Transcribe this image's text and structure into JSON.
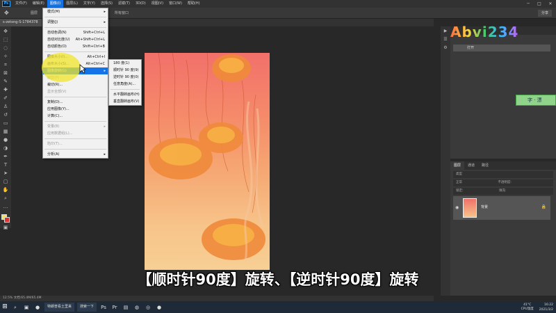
{
  "menubar": {
    "logo": "Ps",
    "items": [
      "文件(F)",
      "编辑(E)",
      "图像(I)",
      "图层(L)",
      "文字(Y)",
      "选择(S)",
      "滤镜(T)",
      "3D(D)",
      "视图(V)",
      "窗口(W)",
      "帮助(H)"
    ],
    "active_index": 2
  },
  "options": {
    "layer_select": "图层",
    "all_windows": "所有窗口",
    "share": "分享"
  },
  "document": {
    "tab_title": "s-zetong-S-1784378"
  },
  "status": {
    "zoom_info": "12.5%   文档:65.4M/65.4M"
  },
  "image_menu": {
    "items": [
      {
        "label": "模式(M)",
        "shortcut": "",
        "submenu": true,
        "disabled": false
      },
      {
        "sep": true
      },
      {
        "label": "调整(J)",
        "shortcut": "",
        "submenu": true,
        "disabled": false
      },
      {
        "sep": true
      },
      {
        "label": "自动色调(N)",
        "shortcut": "Shift+Ctrl+L",
        "submenu": false,
        "disabled": false
      },
      {
        "label": "自动对比度(U)",
        "shortcut": "Alt+Shift+Ctrl+L",
        "submenu": false,
        "disabled": false
      },
      {
        "label": "自动颜色(O)",
        "shortcut": "Shift+Ctrl+B",
        "submenu": false,
        "disabled": false
      },
      {
        "sep": true
      },
      {
        "label": "图像大小(I)...",
        "shortcut": "Alt+Ctrl+I",
        "submenu": false,
        "disabled": false
      },
      {
        "label": "画布大小(S)...",
        "shortcut": "Alt+Ctrl+C",
        "submenu": false,
        "disabled": false
      },
      {
        "label": "图像旋转(G)",
        "shortcut": "",
        "submenu": true,
        "disabled": false,
        "highlight": true
      },
      {
        "label": "裁剪(P)",
        "shortcut": "",
        "submenu": false,
        "disabled": true
      },
      {
        "label": "裁切(R)...",
        "shortcut": "",
        "submenu": false,
        "disabled": false
      },
      {
        "label": "显示全部(V)",
        "shortcut": "",
        "submenu": false,
        "disabled": true
      },
      {
        "sep": true
      },
      {
        "label": "复制(D)...",
        "shortcut": "",
        "submenu": false,
        "disabled": false
      },
      {
        "label": "应用图像(Y)...",
        "shortcut": "",
        "submenu": false,
        "disabled": false
      },
      {
        "label": "计算(C)...",
        "shortcut": "",
        "submenu": false,
        "disabled": false
      },
      {
        "sep": true
      },
      {
        "label": "变量(B)",
        "shortcut": "",
        "submenu": true,
        "disabled": true
      },
      {
        "label": "应用数据组(L)...",
        "shortcut": "",
        "submenu": false,
        "disabled": true
      },
      {
        "sep": true
      },
      {
        "label": "陷印(T)...",
        "shortcut": "",
        "submenu": false,
        "disabled": true
      },
      {
        "sep": true
      },
      {
        "label": "分析(A)",
        "shortcut": "",
        "submenu": true,
        "disabled": false
      }
    ]
  },
  "rotation_submenu": {
    "items": [
      {
        "label": "180 度(1)"
      },
      {
        "label": "顺时针 90 度(9)"
      },
      {
        "label": "逆时针 90 度(0)"
      },
      {
        "label": "任意角度(A)..."
      },
      {
        "sep": true
      },
      {
        "label": "水平翻转画布(H)"
      },
      {
        "label": "垂直翻转画布(V)"
      }
    ]
  },
  "panels": {
    "history_open": "打开",
    "layer_tabs": [
      "图层",
      "通道",
      "路径"
    ],
    "layer_kind": "类型",
    "blend_mode": "正常",
    "opacity": "不透明度:",
    "lock": "锁定:",
    "fill": "填充:",
    "layer_name": "背景"
  },
  "watermark": "Abvi234",
  "green_tag": "字 · 漂",
  "subtitle": "【顺时针90度】旋转、【逆时针90度】旋转",
  "taskbar": {
    "app1": "特朗普看土里来",
    "app2": "搜索一下",
    "temperature": "41°C",
    "cpu_label": "CPU温度",
    "date": "2021/3/2",
    "time": "16:22"
  },
  "colors": {
    "accent": "#1473e6",
    "foreground_swatch": "#f2e34a",
    "background_swatch": "#e03030"
  }
}
